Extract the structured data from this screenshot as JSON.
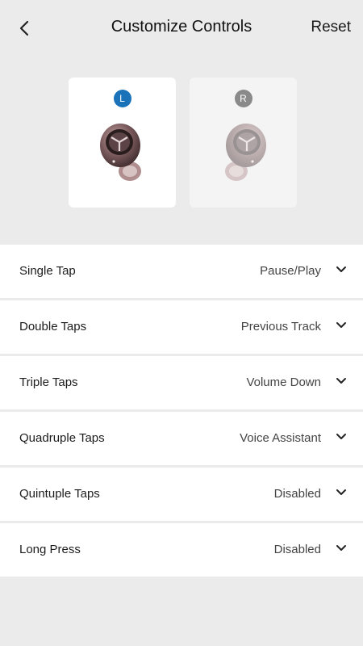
{
  "header": {
    "back_icon": "chevron-left-icon",
    "title": "Customize Controls",
    "reset_label": "Reset"
  },
  "earbuds": {
    "left": {
      "badge": "L",
      "color": "#1a72b8",
      "selected": true
    },
    "right": {
      "badge": "R",
      "color": "#8a8a8a",
      "selected": false
    }
  },
  "controls": [
    {
      "label": "Single Tap",
      "value": "Pause/Play"
    },
    {
      "label": "Double Taps",
      "value": "Previous Track"
    },
    {
      "label": "Triple Taps",
      "value": "Volume Down"
    },
    {
      "label": "Quadruple Taps",
      "value": "Voice Assistant"
    },
    {
      "label": "Quintuple Taps",
      "value": "Disabled"
    },
    {
      "label": "Long Press",
      "value": "Disabled"
    }
  ]
}
